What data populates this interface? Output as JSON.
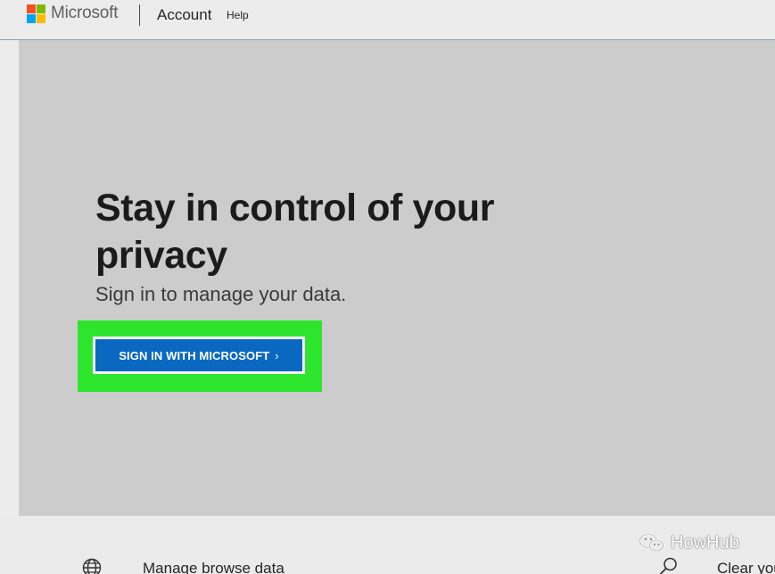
{
  "header": {
    "brand": "Microsoft",
    "account_label": "Account",
    "help_label": "Help"
  },
  "hero": {
    "title": "Stay in control of your privacy",
    "subtitle": "Sign in to manage your data.",
    "button_label": "SIGN IN WITH MICROSOFT",
    "button_chevron": "›"
  },
  "bottom": {
    "manage_label": "Manage browse data",
    "clear_label": "Clear you"
  },
  "watermark": {
    "text": "HowHub"
  },
  "colors": {
    "logo_red": "#f25022",
    "logo_green": "#7fba00",
    "logo_blue": "#00a4ef",
    "logo_yellow": "#ffb900",
    "button_blue": "#0a68c0",
    "highlight_green": "#2ee52e",
    "hero_bg": "#cccccc"
  },
  "icons": {
    "logo": "microsoft-logo",
    "globe": "globe-icon",
    "search": "search-icon",
    "watermark": "wechat-icon"
  }
}
